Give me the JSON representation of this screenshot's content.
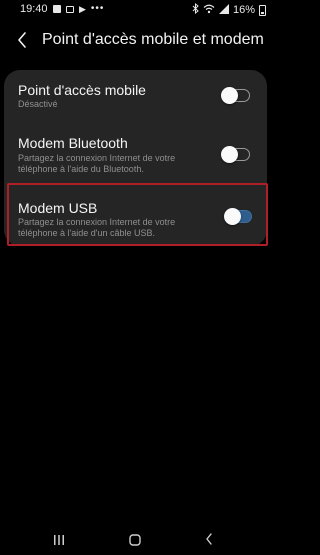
{
  "status_bar": {
    "time": "19:40",
    "battery": "16%",
    "left_icons": [
      "gallery-icon",
      "image-icon",
      "play-icon",
      "more-dots-icon"
    ],
    "right_icons": [
      "bluetooth-icon",
      "wifi-icon",
      "signal-icon",
      "battery-icon"
    ]
  },
  "header": {
    "title": "Point d'accès mobile et modem"
  },
  "settings": {
    "items": [
      {
        "title": "Point d'accès mobile",
        "subtitle": "Désactivé",
        "toggle_on": false
      },
      {
        "title": "Modem Bluetooth",
        "subtitle": "Partagez la connexion Internet de votre téléphone à l'aide du Bluetooth.",
        "toggle_on": false
      },
      {
        "title": "Modem USB",
        "subtitle": "Partagez la connexion Internet de votre téléphone à l'aide d'un câble USB.",
        "toggle_on": true
      }
    ]
  },
  "colors": {
    "background": "#000000",
    "card": "#252525",
    "toggle_on": "#2f5e8e",
    "highlight_border": "#b01e28"
  },
  "nav_bar": {
    "buttons": [
      "recent-apps-icon",
      "home-icon",
      "back-icon"
    ]
  }
}
